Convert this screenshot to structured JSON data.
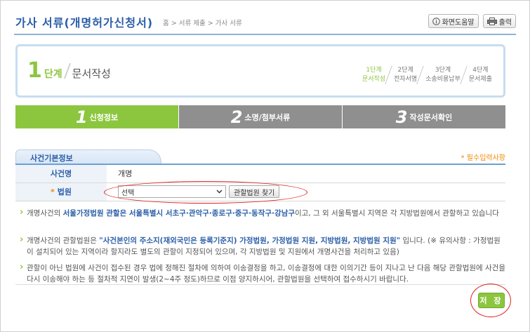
{
  "header": {
    "title": "가사 서류(개명허가신청서)",
    "breadcrumb": "홈 > 서류 제출 > 가사 서류",
    "help_label": "화면도움말",
    "print_label": "출력"
  },
  "stepbox": {
    "current_num": "1",
    "current_unit": "단계",
    "current_name": "문서작성",
    "steps": [
      {
        "line1": "1단계",
        "line2": "문서작성"
      },
      {
        "line1": "2단계",
        "line2": "전자서명"
      },
      {
        "line1": "3단계",
        "line2": "소송비용납부"
      },
      {
        "line1": "4단계",
        "line2": "문서제출"
      }
    ]
  },
  "tabs": [
    {
      "num": "1",
      "label": "신청정보"
    },
    {
      "num": "2",
      "label": "소명/첨부서류"
    },
    {
      "num": "3",
      "label": "작성문서확인"
    }
  ],
  "section": {
    "title": "사건기본정보",
    "required_note": "* 필수입력사항"
  },
  "form": {
    "case_name_label": "사건명",
    "case_name_value": "개명",
    "court_label": "법원",
    "court_required": "*",
    "court_select_value": "선택",
    "find_court_label": "관할법원 찾기"
  },
  "notices": {
    "n1_a": "개명사건의 ",
    "n1_b": "서울가정법원 관할은 서울특별시 서초구·관악구·종로구·중구·동작구·강남구",
    "n1_c": "이고, 그 외 서울특별시 지역은 각 지방법원에서 관할하고 있습니다",
    "n2_a": "개명사건의 관할법원은 ",
    "n2_b": "\"사건본인의 주소지(재외국민은 등록기준지) 가정법원, 가정법원 지원, 지방법원, 지방법원 지원\"",
    "n2_c": " 입니다. (※ 유의사항 : 가정법원이 설치되어 있는 지역이라 할지라도 별도의 관할이 지정되어 있으며, 각 지방법원 및 지원에서 개명사건을 처리하고 있음)",
    "n3": "관할이 아닌 법원에 사건이 접수된 경우 법에 정해진 절차에 의하여 이송결정을 하고, 이송결정에 대한 이의기간 등이 지나고 난 다음 해당 관할법원에 사건을 다시 이송해야 하는 등 절차적 지연이 발생(2~4주 정도)하므로 이점 양지하시어, 관할법원을 선택하여 접수하시기 바랍니다."
  },
  "save_label": "저 장",
  "colors": {
    "accent_green": "#8cc63f",
    "title_blue": "#2b5ea8",
    "highlight_red": "#e02020",
    "required_orange": "#f08a00"
  }
}
